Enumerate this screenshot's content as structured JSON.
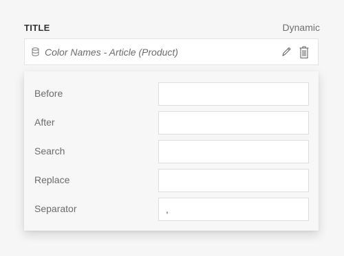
{
  "header": {
    "title": "TITLE",
    "mode": "Dynamic"
  },
  "source": {
    "label": "Color Names - Article (Product)",
    "icons": {
      "source": "database-icon",
      "edit": "pencil-icon",
      "delete": "trash-icon"
    }
  },
  "fields": [
    {
      "label": "Before",
      "value": ""
    },
    {
      "label": "After",
      "value": ""
    },
    {
      "label": "Search",
      "value": ""
    },
    {
      "label": "Replace",
      "value": ""
    },
    {
      "label": "Separator",
      "value": ","
    }
  ],
  "colors": {
    "background": "#f6f6f6",
    "panel": "#f7f7f7",
    "input_border": "#dddddd",
    "text_muted": "#6b6b6b"
  }
}
